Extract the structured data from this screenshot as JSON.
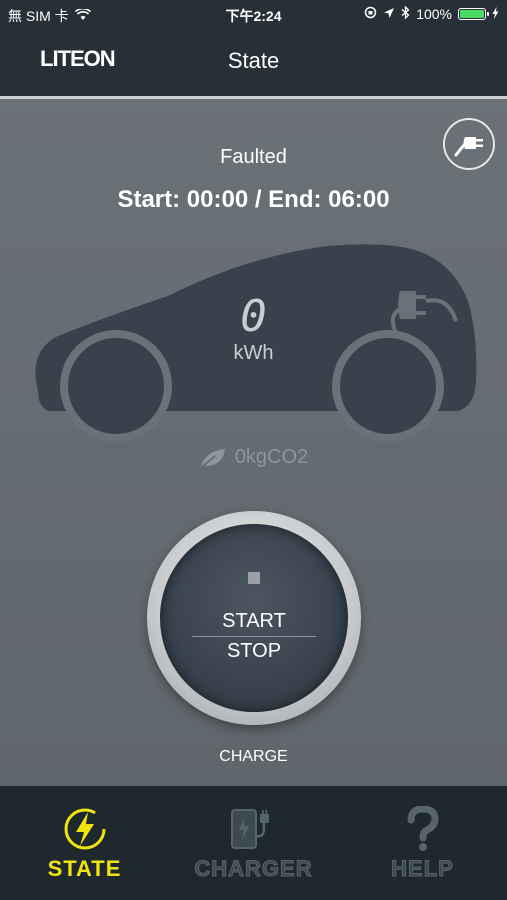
{
  "status_bar": {
    "carrier": "無 SIM 卡",
    "time": "下午2:24",
    "battery": "100%",
    "battery_level": 1.0
  },
  "nav": {
    "logo": "LITEON",
    "title": "State"
  },
  "main": {
    "status": "Faulted",
    "schedule": "Start: 00:00 / End: 06:00",
    "energy_value": "0",
    "energy_unit": "kWh",
    "co2": "0kgCO2",
    "start_label": "START",
    "stop_label": "STOP",
    "charge_label": "CHARGE"
  },
  "tabs": [
    {
      "label": "STATE",
      "icon": "lightning-icon",
      "active": true
    },
    {
      "label": "CHARGER",
      "icon": "charger-icon",
      "active": false
    },
    {
      "label": "HELP",
      "icon": "question-icon",
      "active": false
    }
  ],
  "colors": {
    "active_tab": "#f0e50f",
    "battery_fill": "#4cd964"
  }
}
